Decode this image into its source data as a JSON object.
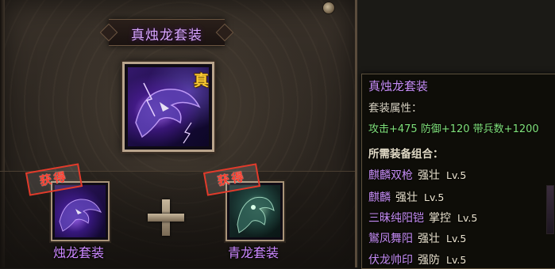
{
  "set_panel": {
    "title": "真烛龙套装",
    "main_item": {
      "badge": "真"
    },
    "components": [
      {
        "stamp": "获得",
        "name": "烛龙套装"
      },
      {
        "stamp": "获得",
        "name": "青龙套装"
      }
    ]
  },
  "tooltip": {
    "title": "真烛龙套装",
    "attr_header": "套装属性：",
    "attributes": "攻击+475 防御+120 带兵数+1200",
    "required_header": "所需装备组合：",
    "items": [
      {
        "name": "麒麟双枪",
        "quality": "强壮",
        "level": "Lv.5"
      },
      {
        "name": "麒麟",
        "quality": "强壮",
        "level": "Lv.5"
      },
      {
        "name": "三昧纯阳铠",
        "quality": "掌控",
        "level": "Lv.5"
      },
      {
        "name": "鸑凤舞阳",
        "quality": "强壮",
        "level": "Lv.5"
      },
      {
        "name": "伏龙帅印",
        "quality": "强防",
        "level": "Lv.5"
      }
    ]
  },
  "colors": {
    "purple_text": "#c58cf5",
    "green_text": "#7fe07a",
    "stamp_red": "#e23a2a",
    "badge_gold": "#ffcc33"
  },
  "icons": {
    "main": "purple-dragon-icon",
    "component_a": "purple-dragon-icon",
    "component_b": "green-dragon-icon",
    "combine": "plus-icon"
  }
}
